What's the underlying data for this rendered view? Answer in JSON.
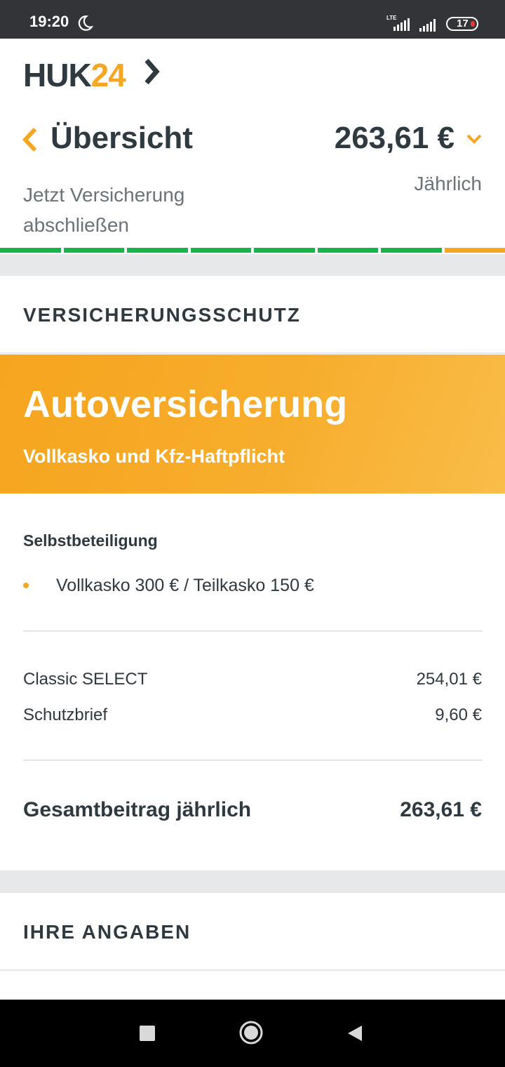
{
  "statusbar": {
    "time": "19:20",
    "net1": "LTE",
    "battery": "17"
  },
  "logo": {
    "huk": "HUK",
    "num": "24"
  },
  "header": {
    "title": "Übersicht",
    "subtitle": "Jetzt Versicherung abschließen",
    "price": "263,61 €",
    "period": "Jährlich"
  },
  "progress": {
    "steps_total": 8,
    "current_step": 8
  },
  "section1": {
    "heading": "VERSICHERUNGSSCHUTZ"
  },
  "banner": {
    "title": "Autoversicherung",
    "subtitle": "Vollkasko und Kfz-Haftpflicht"
  },
  "deductible": {
    "label": "Selbstbeteiligung",
    "item": "Vollkasko 300 € / Teilkasko 150 €"
  },
  "items": [
    {
      "name": "Classic SELECT",
      "price": "254,01 €"
    },
    {
      "name": "Schutzbrief",
      "price": "9,60 €"
    }
  ],
  "total": {
    "label": "Gesamtbeitrag jährlich",
    "price": "263,61 €"
  },
  "section2": {
    "heading": "IHRE ANGABEN"
  },
  "colors": {
    "accent": "#f5a623",
    "progress_done": "#15b54a",
    "text": "#2f3a40"
  }
}
